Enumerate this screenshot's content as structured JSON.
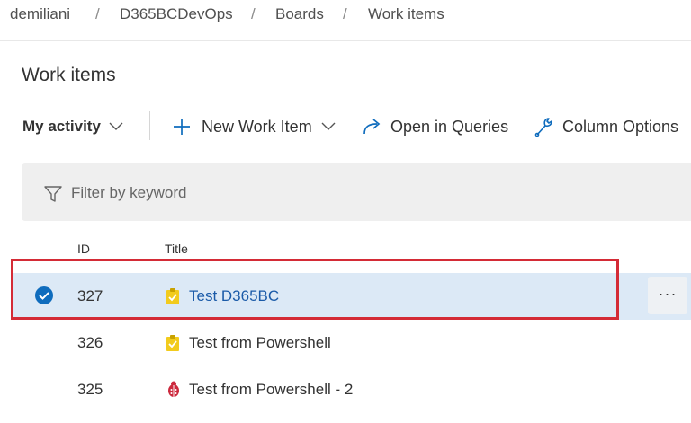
{
  "breadcrumb": [
    "demiliani",
    "D365BCDevOps",
    "Boards",
    "Work items"
  ],
  "breadcrumb_separator": "/",
  "page_title": "Work items",
  "toolbar": {
    "view_label": "My activity",
    "new_item_label": "New Work Item",
    "open_queries_label": "Open in Queries",
    "column_options_label": "Column Options"
  },
  "filter": {
    "placeholder": "Filter by keyword"
  },
  "table": {
    "headers": {
      "id": "ID",
      "title": "Title"
    },
    "rows": [
      {
        "id": "327",
        "title": "Test D365BC",
        "type": "task",
        "selected": true
      },
      {
        "id": "326",
        "title": "Test from Powershell",
        "type": "task",
        "selected": false
      },
      {
        "id": "325",
        "title": "Test from Powershell - 2",
        "type": "bug",
        "selected": false
      }
    ],
    "more_label": "···"
  },
  "colors": {
    "selected_row": "#dce9f6",
    "link": "#1a5aa8",
    "check": "#0f6cbd",
    "task_icon": "#f2cb1d",
    "bug_icon": "#cc293d",
    "highlight_border": "#d42b36"
  }
}
